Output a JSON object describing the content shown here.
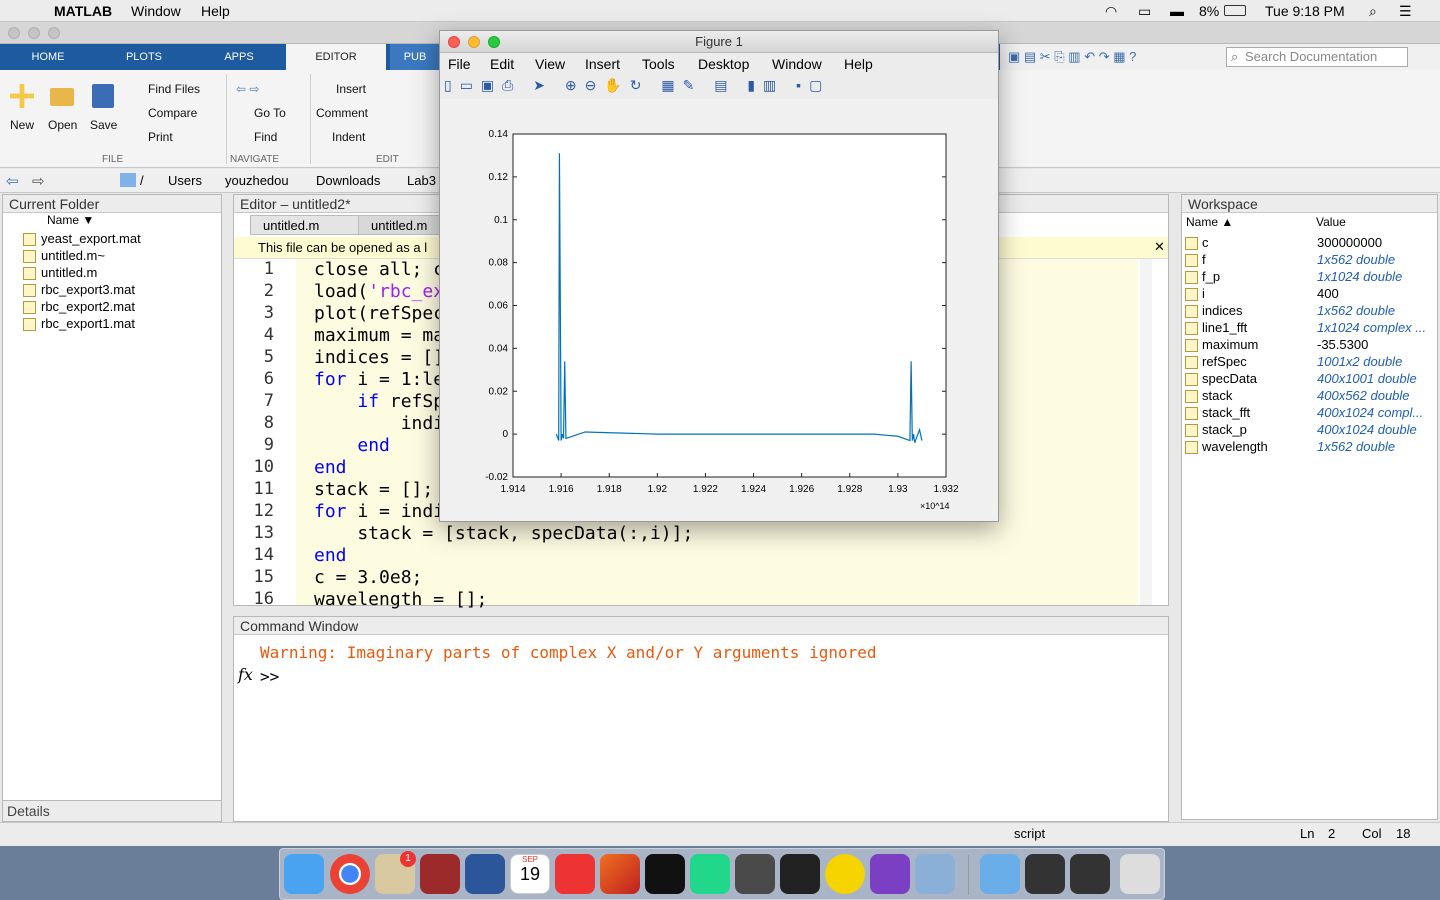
{
  "menubar": {
    "app": "MATLAB",
    "items": [
      "Window",
      "Help"
    ],
    "battery": "8%",
    "clock": "Tue 9:18 PM"
  },
  "ribbon": {
    "tabs": [
      "HOME",
      "PLOTS",
      "APPS",
      "EDITOR",
      "PUB"
    ],
    "new": "New",
    "open": "Open",
    "save": "Save",
    "find_files": "Find Files",
    "compare": "Compare",
    "print": "Print",
    "go_to": "Go To",
    "find": "Find",
    "insert": "Insert",
    "comment": "Comment",
    "indent": "Indent",
    "sec_file": "FILE",
    "sec_navigate": "NAVIGATE",
    "sec_edit": "EDIT",
    "search_placeholder": "Search Documentation"
  },
  "address": {
    "path": [
      "/",
      "Users",
      "youzhedou",
      "Downloads",
      "Lab3"
    ]
  },
  "current_folder": {
    "title": "Current Folder",
    "col_name": "Name ▼",
    "files": [
      "yeast_export.mat",
      "untitled.m~",
      "untitled.m",
      "rbc_export3.mat",
      "rbc_export2.mat",
      "rbc_export1.mat"
    ],
    "details": "Details"
  },
  "editor": {
    "title": "Editor – untitled2*",
    "tabs": [
      "untitled.m",
      "untitled.m"
    ],
    "banner": "This file can be opened as a l",
    "lines": [
      {
        "n": "1",
        "t": "close all; c"
      },
      {
        "n": "2",
        "t": "load('rbc_ex"
      },
      {
        "n": "3",
        "t": "plot(refSpec"
      },
      {
        "n": "4",
        "t": "maximum = ma"
      },
      {
        "n": "5",
        "t": "indices = []"
      },
      {
        "n": "6",
        "t": "for i = 1:le"
      },
      {
        "n": "7",
        "t": "    if refSp"
      },
      {
        "n": "8",
        "t": "        indi"
      },
      {
        "n": "9",
        "t": "    end"
      },
      {
        "n": "10",
        "t": "end"
      },
      {
        "n": "11",
        "t": "stack = [];"
      },
      {
        "n": "12",
        "t": "for i = indi"
      },
      {
        "n": "13",
        "t": "    stack = [stack, specData(:,i)];"
      },
      {
        "n": "14",
        "t": "end"
      },
      {
        "n": "15",
        "t": "c = 3.0e8;"
      },
      {
        "n": "16",
        "t": "wavelength = [];"
      }
    ]
  },
  "command_window": {
    "title": "Command Window",
    "warning": "Warning: Imaginary parts of complex X and/or Y arguments ignored",
    "prompt": ">>",
    "fx": "fx"
  },
  "workspace": {
    "title": "Workspace",
    "col_name": "Name ▲",
    "col_value": "Value",
    "vars": [
      {
        "name": "c",
        "value": "300000000",
        "italic": false
      },
      {
        "name": "f",
        "value": "1x562 double",
        "italic": true
      },
      {
        "name": "f_p",
        "value": "1x1024 double",
        "italic": true
      },
      {
        "name": "i",
        "value": "400",
        "italic": false
      },
      {
        "name": "indices",
        "value": "1x562 double",
        "italic": true
      },
      {
        "name": "line1_fft",
        "value": "1x1024 complex ...",
        "italic": true
      },
      {
        "name": "maximum",
        "value": "-35.5300",
        "italic": false
      },
      {
        "name": "refSpec",
        "value": "1001x2 double",
        "italic": true
      },
      {
        "name": "specData",
        "value": "400x1001 double",
        "italic": true
      },
      {
        "name": "stack",
        "value": "400x562 double",
        "italic": true
      },
      {
        "name": "stack_fft",
        "value": "400x1024 compl...",
        "italic": true
      },
      {
        "name": "stack_p",
        "value": "400x1024 double",
        "italic": true
      },
      {
        "name": "wavelength",
        "value": "1x562 double",
        "italic": true
      }
    ]
  },
  "status": {
    "mode": "script",
    "ln_label": "Ln",
    "ln": "2",
    "col_label": "Col",
    "col": "18"
  },
  "figure": {
    "title": "Figure 1",
    "menu": [
      "File",
      "Edit",
      "View",
      "Insert",
      "Tools",
      "Desktop",
      "Window",
      "Help"
    ],
    "chart_data": {
      "type": "line",
      "title": "",
      "xlabel": "",
      "ylabel": "",
      "x_exponent": "×10^14",
      "xlim": [
        1.914,
        1.932
      ],
      "ylim": [
        -0.02,
        0.14
      ],
      "xticks": [
        "1.914",
        "1.916",
        "1.918",
        "1.92",
        "1.922",
        "1.924",
        "1.926",
        "1.928",
        "1.93",
        "1.932"
      ],
      "yticks": [
        "-0.02",
        "0",
        "0.02",
        "0.04",
        "0.06",
        "0.08",
        "0.1",
        "0.12",
        "0.14"
      ],
      "series": [
        {
          "color": "#0072bd",
          "x": [
            1.9158,
            1.9159,
            1.91593,
            1.916,
            1.91605,
            1.9161,
            1.91615,
            1.9162,
            1.917,
            1.92,
            1.925,
            1.929,
            1.93,
            1.9305,
            1.93055,
            1.9306,
            1.93065,
            1.9307,
            1.9309,
            1.931
          ],
          "y": [
            0.0,
            -0.003,
            0.131,
            -0.003,
            0.0,
            -0.002,
            0.034,
            -0.002,
            0.001,
            0.0,
            0.0,
            0.0,
            -0.001,
            -0.003,
            0.034,
            -0.003,
            0.0,
            -0.004,
            0.002,
            -0.003
          ]
        }
      ]
    }
  },
  "dock": {
    "badge": "1",
    "calendar_month": "SEP",
    "calendar_day": "19"
  }
}
